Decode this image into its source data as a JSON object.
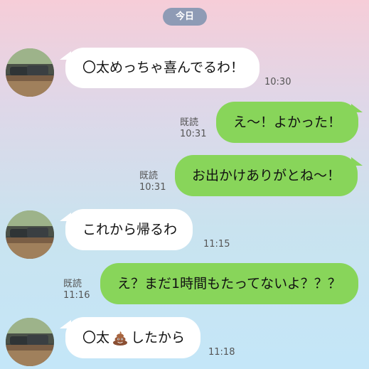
{
  "date_label": "今日",
  "read_label": "既読",
  "colors": {
    "incoming": "#ffffff",
    "outgoing": "#88d55a",
    "date_pill": "#8e9bb5"
  },
  "messages": [
    {
      "side": "in",
      "text": "〇太めっちゃ喜んでるわ！",
      "time": "10:30"
    },
    {
      "side": "out",
      "text": "え〜！よかった！",
      "time": "10:31",
      "read": true
    },
    {
      "side": "out",
      "text": "お出かけありがとね〜！",
      "time": "10:31",
      "read": true
    },
    {
      "side": "in",
      "text": "これから帰るわ",
      "time": "11:15"
    },
    {
      "side": "out",
      "text": "え？まだ1時間もたってないよ？？？",
      "time": "11:16",
      "read": true
    },
    {
      "side": "in",
      "text_before": "〇太",
      "emoji": "poop-emoji",
      "text_after": "したから",
      "time": "11:18"
    }
  ]
}
